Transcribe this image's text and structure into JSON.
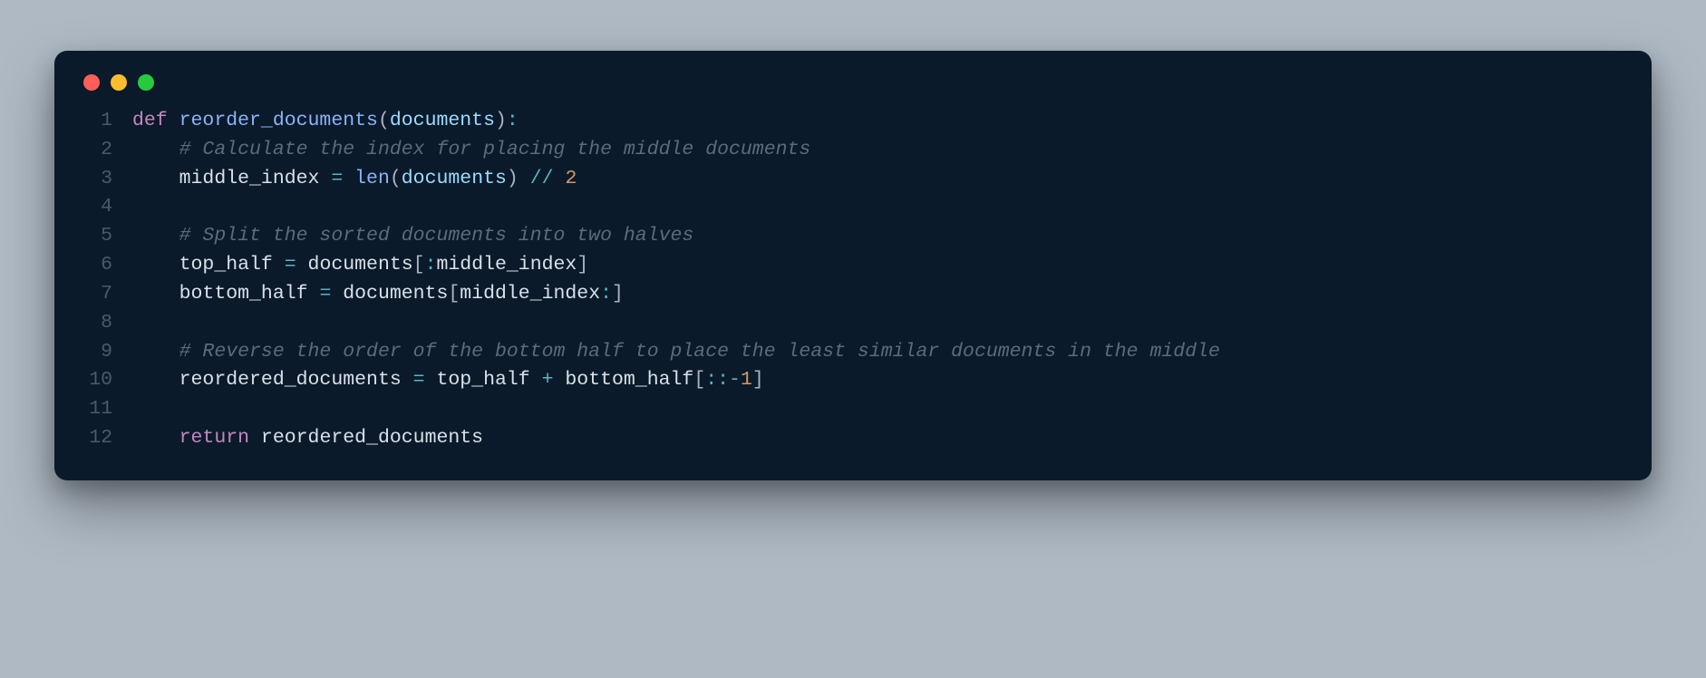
{
  "window": {
    "traffic_lights": [
      "red",
      "yellow",
      "green"
    ]
  },
  "code": {
    "lines": [
      {
        "n": "1",
        "tokens": [
          {
            "c": "tok-kw",
            "t": "def "
          },
          {
            "c": "tok-fn",
            "t": "reorder_documents"
          },
          {
            "c": "tok-punc",
            "t": "("
          },
          {
            "c": "tok-param",
            "t": "documents"
          },
          {
            "c": "tok-punc",
            "t": ")"
          },
          {
            "c": "tok-op",
            "t": ":"
          }
        ]
      },
      {
        "n": "2",
        "tokens": [
          {
            "c": "",
            "t": "    "
          },
          {
            "c": "tok-cmt",
            "t": "# Calculate the index for placing the middle documents"
          }
        ]
      },
      {
        "n": "3",
        "tokens": [
          {
            "c": "",
            "t": "    "
          },
          {
            "c": "tok-id",
            "t": "middle_index "
          },
          {
            "c": "tok-op",
            "t": "="
          },
          {
            "c": "tok-id",
            "t": " "
          },
          {
            "c": "tok-fn",
            "t": "len"
          },
          {
            "c": "tok-punc",
            "t": "("
          },
          {
            "c": "tok-param",
            "t": "documents"
          },
          {
            "c": "tok-punc",
            "t": ")"
          },
          {
            "c": "tok-id",
            "t": " "
          },
          {
            "c": "tok-op",
            "t": "//"
          },
          {
            "c": "tok-id",
            "t": " "
          },
          {
            "c": "tok-num",
            "t": "2"
          }
        ]
      },
      {
        "n": "4",
        "tokens": []
      },
      {
        "n": "5",
        "tokens": [
          {
            "c": "",
            "t": "    "
          },
          {
            "c": "tok-cmt",
            "t": "# Split the sorted documents into two halves"
          }
        ]
      },
      {
        "n": "6",
        "tokens": [
          {
            "c": "",
            "t": "    "
          },
          {
            "c": "tok-id",
            "t": "top_half "
          },
          {
            "c": "tok-op",
            "t": "="
          },
          {
            "c": "tok-id",
            "t": " documents"
          },
          {
            "c": "tok-punc",
            "t": "["
          },
          {
            "c": "tok-op",
            "t": ":"
          },
          {
            "c": "tok-id",
            "t": "middle_index"
          },
          {
            "c": "tok-punc",
            "t": "]"
          }
        ]
      },
      {
        "n": "7",
        "tokens": [
          {
            "c": "",
            "t": "    "
          },
          {
            "c": "tok-id",
            "t": "bottom_half "
          },
          {
            "c": "tok-op",
            "t": "="
          },
          {
            "c": "tok-id",
            "t": " documents"
          },
          {
            "c": "tok-punc",
            "t": "["
          },
          {
            "c": "tok-id",
            "t": "middle_index"
          },
          {
            "c": "tok-op",
            "t": ":"
          },
          {
            "c": "tok-punc",
            "t": "]"
          }
        ]
      },
      {
        "n": "8",
        "tokens": []
      },
      {
        "n": "9",
        "tokens": [
          {
            "c": "",
            "t": "    "
          },
          {
            "c": "tok-cmt",
            "t": "# Reverse the order of the bottom half to place the least similar documents in the middle"
          }
        ]
      },
      {
        "n": "10",
        "tokens": [
          {
            "c": "",
            "t": "    "
          },
          {
            "c": "tok-id",
            "t": "reordered_documents "
          },
          {
            "c": "tok-op",
            "t": "="
          },
          {
            "c": "tok-id",
            "t": " top_half "
          },
          {
            "c": "tok-op",
            "t": "+"
          },
          {
            "c": "tok-id",
            "t": " bottom_half"
          },
          {
            "c": "tok-punc",
            "t": "["
          },
          {
            "c": "tok-op",
            "t": "::"
          },
          {
            "c": "tok-op",
            "t": "-"
          },
          {
            "c": "tok-num",
            "t": "1"
          },
          {
            "c": "tok-punc",
            "t": "]"
          }
        ]
      },
      {
        "n": "11",
        "tokens": []
      },
      {
        "n": "12",
        "tokens": [
          {
            "c": "",
            "t": "    "
          },
          {
            "c": "tok-kw",
            "t": "return"
          },
          {
            "c": "tok-id",
            "t": " reordered_documents"
          }
        ]
      }
    ]
  }
}
